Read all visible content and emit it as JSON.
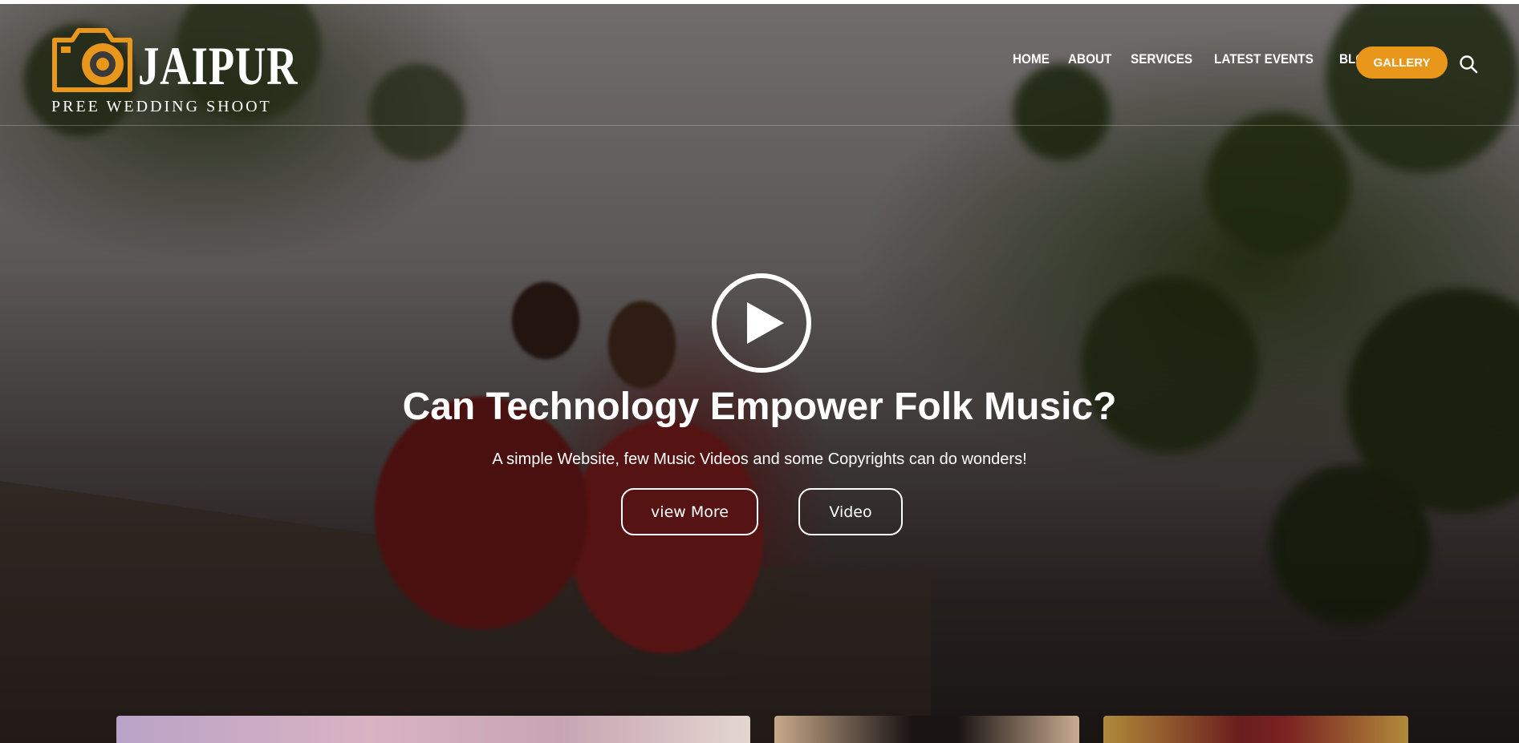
{
  "brand": {
    "title": "JAIPUR",
    "subtitle": "PREE WEDDING SHOOT",
    "accent_color": "#e8971a"
  },
  "nav": {
    "items": [
      "HOME",
      "ABOUT",
      "SERVICES",
      "LATEST EVENTS",
      "BLOG"
    ],
    "gallery_label": "GALLERY",
    "search_icon": "search-icon"
  },
  "hero": {
    "play_icon": "play-icon",
    "title": "Can Technology Empower Folk Music?",
    "subtitle": "A simple Website, few Music Videos and some Copyrights can do wonders!",
    "view_more_label": "view More",
    "video_label": "Video"
  }
}
